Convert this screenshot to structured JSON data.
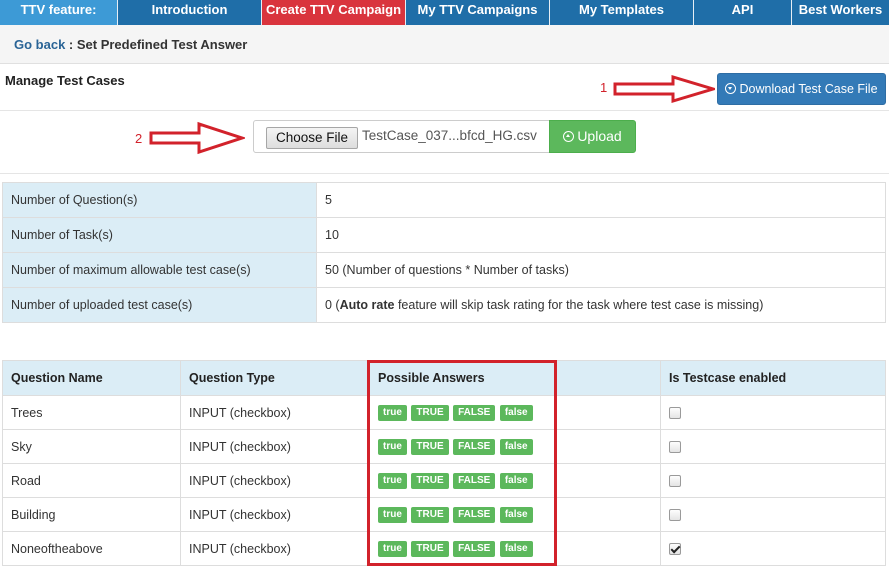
{
  "nav": {
    "feature_label": "TTV feature:",
    "items": [
      "Introduction",
      "Create TTV Campaign",
      "My TTV Campaigns",
      "My Templates",
      "API",
      "Best Workers"
    ]
  },
  "breadcrumb": {
    "back": "Go back",
    "separator": " : ",
    "current": "Set Predefined Test Answer"
  },
  "manage": {
    "title": "Manage Test Cases",
    "download_label": "Download Test Case File"
  },
  "markers": {
    "one": "1",
    "two": "2"
  },
  "upload": {
    "choose_label": "Choose File",
    "file_name": "TestCase_037...bfcd_HG.csv",
    "upload_label": "Upload"
  },
  "stats": [
    {
      "label": "Number of Question(s)",
      "value": "5"
    },
    {
      "label": "Number of Task(s)",
      "value": "10"
    },
    {
      "label": "Number of maximum allowable test case(s)",
      "value": "50 (Number of questions * Number of tasks)"
    },
    {
      "label": "Number of uploaded test case(s)",
      "value_prefix": "0 (",
      "value_bold": "Auto rate",
      "value_suffix": " feature will skip task rating for the task where test case is missing)"
    }
  ],
  "questions": {
    "headers": [
      "Question Name",
      "Question Type",
      "Possible Answers",
      "Is Testcase enabled"
    ],
    "answers": [
      "true",
      "TRUE",
      "FALSE",
      "false"
    ],
    "rows": [
      {
        "name": "Trees",
        "type": "INPUT (checkbox)",
        "enabled": false
      },
      {
        "name": "Sky",
        "type": "INPUT (checkbox)",
        "enabled": false
      },
      {
        "name": "Road",
        "type": "INPUT (checkbox)",
        "enabled": false
      },
      {
        "name": "Building",
        "type": "INPUT (checkbox)",
        "enabled": false
      },
      {
        "name": "Noneoftheabove",
        "type": "INPUT (checkbox)",
        "enabled": true
      }
    ]
  },
  "colors": {
    "nav": "#1f6ea8",
    "nav_feature": "#3d9ad6",
    "nav_active": "#d9343d",
    "primary": "#337ab7",
    "success": "#5cb85c",
    "highlight": "#d2222b",
    "table_header": "#dbedf6"
  }
}
